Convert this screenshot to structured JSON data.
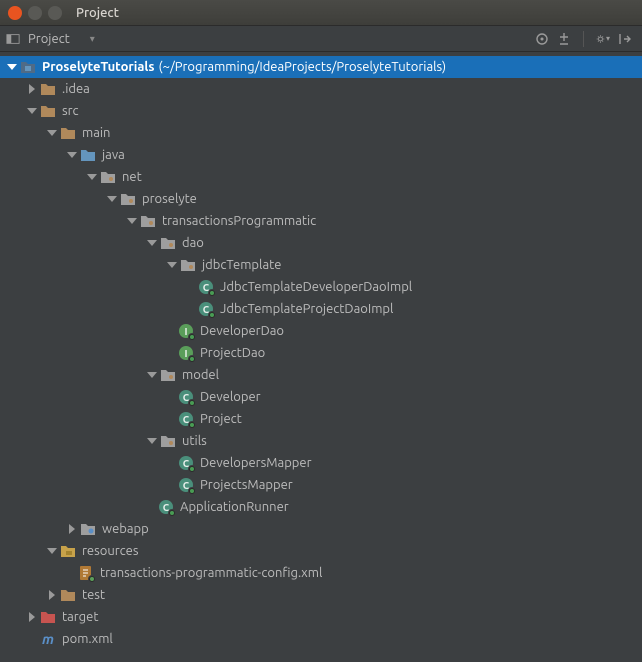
{
  "window": {
    "title": "Project",
    "buttons": {
      "close_color": "#e95420",
      "min_color": "#595955",
      "max_color": "#595955"
    }
  },
  "toolbar": {
    "view_label": "Project"
  },
  "tree": {
    "root": {
      "name": "ProselyteTutorials",
      "suffix": "(~/Programming/IdeaProjects/ProselyteTutorials)"
    },
    "idea": ".idea",
    "src": "src",
    "main": "main",
    "java": "java",
    "net": "net",
    "proselyte": "proselyte",
    "transactions": "transactionsProgrammatic",
    "dao": "dao",
    "jdbcTemplate": "jdbcTemplate",
    "jdbcDevDao": "JdbcTemplateDeveloperDaoImpl",
    "jdbcProjDao": "JdbcTemplateProjectDaoImpl",
    "developerDao": "DeveloperDao",
    "projectDao": "ProjectDao",
    "model": "model",
    "developer": "Developer",
    "project": "Project",
    "utils": "utils",
    "devMapper": "DevelopersMapper",
    "projMapper": "ProjectsMapper",
    "appRunner": "ApplicationRunner",
    "webapp": "webapp",
    "resources": "resources",
    "config": "transactions-programmatic-config.xml",
    "test": "test",
    "target": "target",
    "pom": "pom.xml"
  },
  "colors": {
    "folder": "#b0895b",
    "package": "#9e9e9e",
    "srcRoot": "#6495bd",
    "resourcesRoot": "#c7a24a",
    "classBadge": "#4a8f7b",
    "interfaceBadge": "#5a9e5a",
    "xmlBadge": "#b07935",
    "target": "#c75450",
    "maven": "#5a8fc7"
  }
}
